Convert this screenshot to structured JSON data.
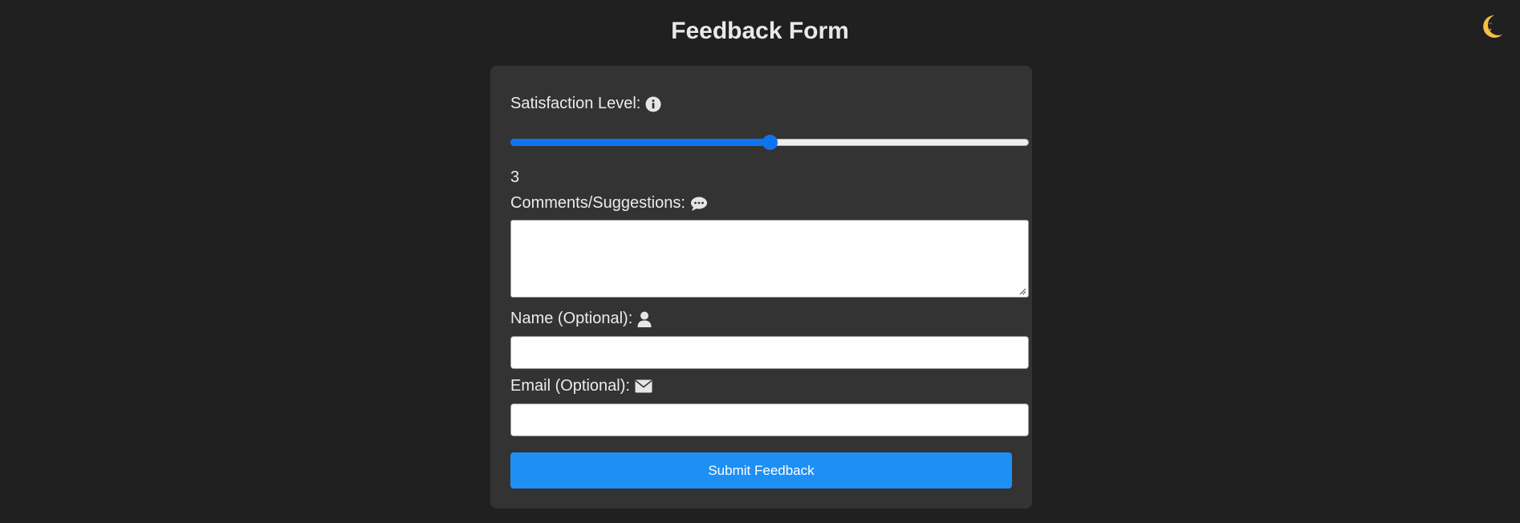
{
  "header": {
    "title": "Feedback Form",
    "theme_toggle_icon": "crescent-moon-icon"
  },
  "form": {
    "satisfaction": {
      "label": "Satisfaction Level:",
      "icon": "info-circle-icon",
      "min": 1,
      "max": 5,
      "value": 3,
      "value_display": "3"
    },
    "comments": {
      "label": "Comments/Suggestions:",
      "icon": "comment-icon",
      "value": "",
      "placeholder": ""
    },
    "name": {
      "label": "Name (Optional):",
      "icon": "user-icon",
      "value": "",
      "placeholder": ""
    },
    "email": {
      "label": "Email (Optional):",
      "icon": "envelope-icon",
      "value": "",
      "placeholder": ""
    },
    "submit_label": "Submit Feedback"
  },
  "colors": {
    "background": "#202020",
    "card": "#333333",
    "accent": "#1e8ff5",
    "slider_accent": "#0f73f0"
  }
}
